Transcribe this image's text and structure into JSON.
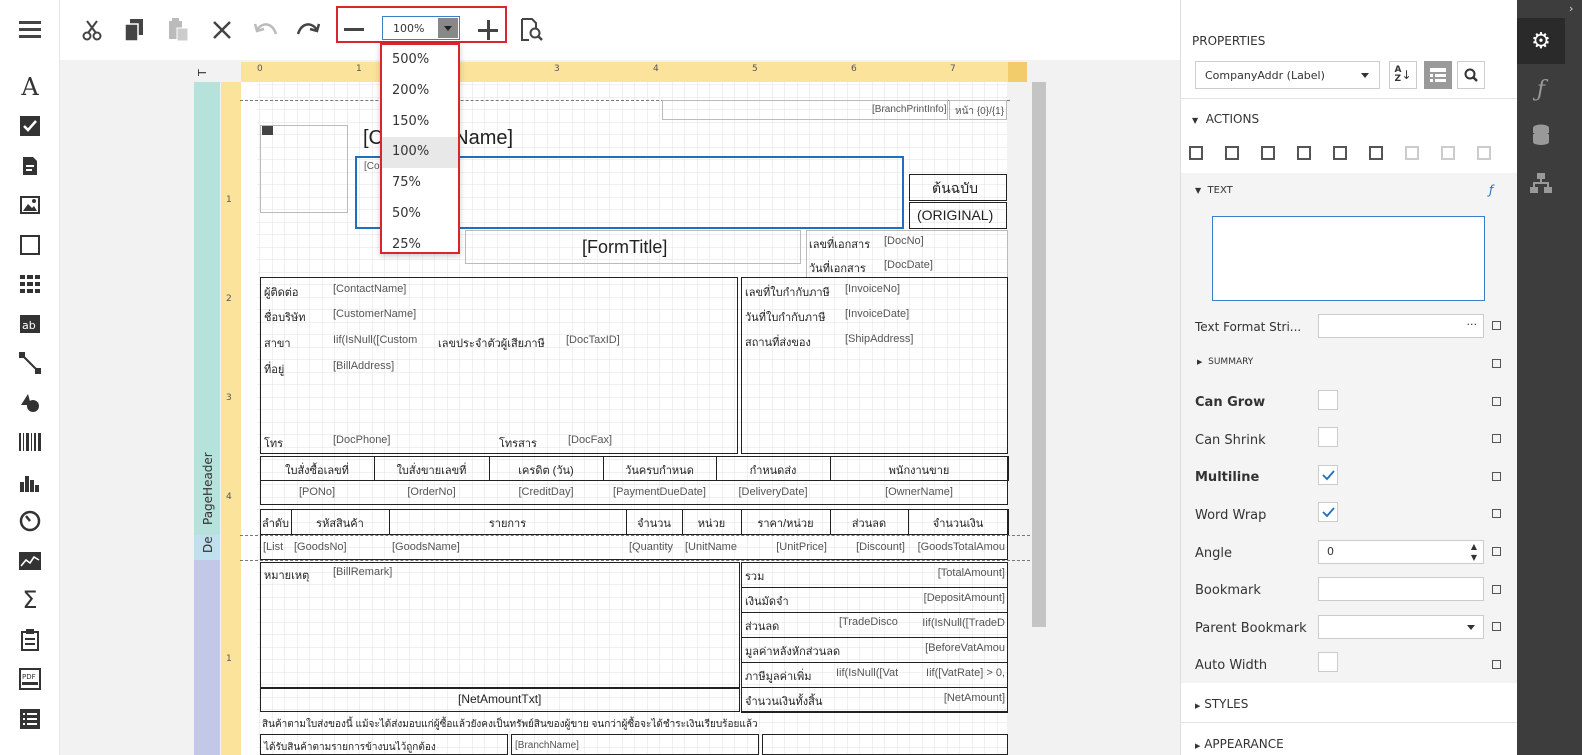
{
  "toolbox": {
    "items": [
      "menu-icon",
      "label-icon",
      "checkbox-icon",
      "rich-text-icon",
      "picture-icon",
      "panel-icon",
      "table-icon",
      "character-comb-icon",
      "line-icon",
      "shape-icon",
      "barcode-icon",
      "chart-icon",
      "gauge-icon",
      "sparkline-icon",
      "summary-icon",
      "subreport-icon",
      "pdf-content-icon",
      "table-of-contents-icon"
    ]
  },
  "toolbar": {
    "zoom_value": "100%",
    "zoom_options": [
      "500%",
      "200%",
      "150%",
      "100%",
      "75%",
      "50%",
      "25%"
    ],
    "selected_zoom": "100%"
  },
  "ruler": {
    "h_ticks": [
      "0",
      "1",
      "2",
      "3",
      "4",
      "5",
      "6",
      "7"
    ],
    "v_ticks_top": [
      "1",
      "2",
      "3",
      "4"
    ],
    "v_ticks_bottom": [
      "1"
    ]
  },
  "bands": {
    "top": "T",
    "page_header": "PageHeader",
    "detail": "De"
  },
  "report": {
    "branch_print_info": "[BranchPrintInfo]",
    "page_no": "หน้า {0}/{1}",
    "company_name": "[CompanyName]",
    "company_addr": "[Co",
    "original_th": "ต้นฉบับ",
    "original_en": "(ORIGINAL)",
    "form_title": "[FormTitle]",
    "doc_no_label": "เลขที่เอกสาร",
    "doc_no": "[DocNo]",
    "doc_date_label": "วันที่เอกสาร",
    "doc_date": "[DocDate]",
    "contact_label": "ผู้ติดต่อ",
    "contact": "[ContactName]",
    "company_label": "ชื่อบริษัท",
    "customer": "[CustomerName]",
    "branch_label": "สาขา",
    "branch_expr": "Iif(IsNull([Custom",
    "tax_label": "เลขประจำตัวผู้เสียภาษี",
    "tax_id": "[DocTaxID]",
    "address_label": "ที่อยู่",
    "bill_address": "[BillAddress]",
    "phone_label": "โทร",
    "phone": "[DocPhone]",
    "fax_label": "โทรสาร",
    "fax": "[DocFax]",
    "invoice_no_label": "เลขที่ใบกำกับภาษี",
    "invoice_no": "[InvoiceNo]",
    "invoice_date_label": "วันที่ใบกำกับภาษี",
    "invoice_date": "[InvoiceDate]",
    "ship_label": "สถานที่ส่งของ",
    "ship_address": "[ShipAddress]",
    "hdr2": [
      "ใบสั่งซื้อเลขที่",
      "ใบสั่งขายเลขที่",
      "เครดิต (วัน)",
      "วันครบกำหนด",
      "กำหนดส่ง",
      "พนักงานขาย"
    ],
    "val2": [
      "[PONo]",
      "[OrderNo]",
      "[CreditDay]",
      "[PaymentDueDate]",
      "[DeliveryDate]",
      "[OwnerName]"
    ],
    "hdr3": [
      "ลำดับ",
      "รหัสสินค้า",
      "รายการ",
      "จำนวน",
      "หน่วย",
      "ราคา/หน่วย",
      "ส่วนลด",
      "จำนวนเงิน"
    ],
    "val3": [
      "[List",
      "[GoodsNo]",
      "[GoodsName]",
      "[Quantity",
      "[UnitName",
      "[UnitPrice]",
      "[Discount]",
      "[GoodsTotalAmou"
    ],
    "remark_label": "หมายเหตุ",
    "remark": "[BillRemark]",
    "sum_labels": [
      "รวม",
      "เงินมัดจำ",
      "ส่วนลด",
      "มูลค่าหลังหักส่วนลด",
      "ภาษีมูลค่าเพิ่ม",
      "จำนวนเงินทั้งสิ้น"
    ],
    "sum_values": [
      "[TotalAmount]",
      "[DepositAmount]",
      "Iif(IsNull([TradeD",
      "[BeforeVatAmou",
      "Iif([VatRate] > 0,",
      "[NetAmount]"
    ],
    "trade_disc": "[TradeDisco",
    "vat_expr": "Iif(IsNull([Vat",
    "net_text": "[NetAmountTxt]",
    "footer_note": "สินค้าตามใบส่งของนี้ แม้จะได้ส่งมอบแก่ผู้ซื้อแล้วยังคงเป็นทรัพย์สินของผู้ขาย จนกว่าผู้ซื้อจะได้ชำระเงินเรียบร้อยแล้ว",
    "receive_label": "ได้รับสินค้าตามรายการข้างบนไว้ถูกต้อง",
    "branch_name": "[BranchName]"
  },
  "properties": {
    "title": "PROPERTIES",
    "selected_component": "CompanyAddr (Label)",
    "actions_label": "ACTIONS",
    "text_section": "TEXT",
    "text_value": "",
    "text_format_label": "Text Format Stri...",
    "text_format_ellipsis": "···",
    "summary_label": "SUMMARY",
    "can_grow_label": "Can Grow",
    "can_shrink_label": "Can Shrink",
    "multiline_label": "Multiline",
    "word_wrap_label": "Word Wrap",
    "angle_label": "Angle",
    "angle_value": "0",
    "bookmark_label": "Bookmark",
    "parent_bookmark_label": "Parent Bookmark",
    "auto_width_label": "Auto Width",
    "styles_label": "STYLES",
    "appearance_label": "APPEARANCE",
    "can_grow": false,
    "can_shrink": false,
    "multiline": true,
    "word_wrap": true,
    "auto_width": false
  },
  "colors": {
    "accent": "#d9262c",
    "selection": "#1e6fbf",
    "top_band": "#b5e3dc",
    "detail_band": "#c3c8e8",
    "ruler": "#fbe39c",
    "right_tabs": "#3d3d3d"
  }
}
